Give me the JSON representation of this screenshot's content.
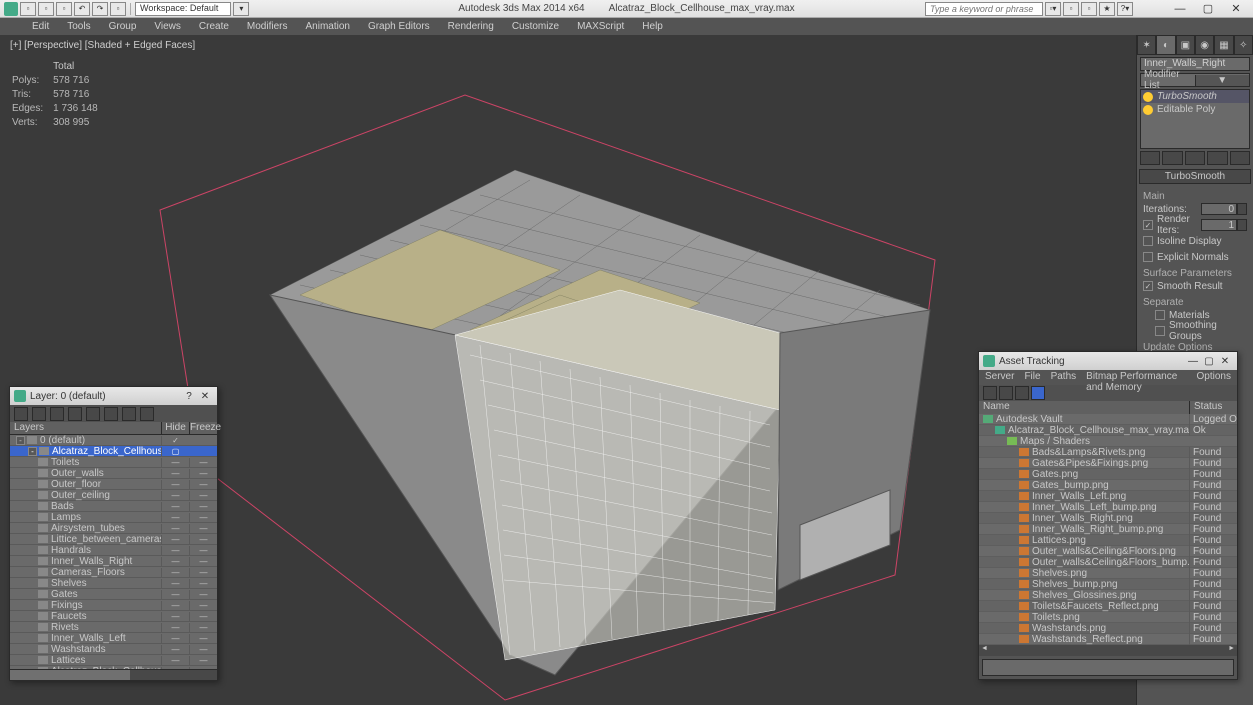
{
  "titlebar": {
    "workspace_label": "Workspace: Default",
    "app_title": "Autodesk 3ds Max 2014 x64",
    "file_title": "Alcatraz_Block_Cellhouse_max_vray.max",
    "search_placeholder": "Type a keyword or phrase",
    "quick_icons": [
      "new",
      "open",
      "save",
      "undo",
      "redo",
      "link",
      "select"
    ]
  },
  "menu": [
    "Edit",
    "Tools",
    "Group",
    "Views",
    "Create",
    "Modifiers",
    "Animation",
    "Graph Editors",
    "Rendering",
    "Customize",
    "MAXScript",
    "Help"
  ],
  "viewport": {
    "label": "[+] [Perspective] [Shaded + Edged Faces]",
    "stats_header": "Total",
    "stats": [
      {
        "k": "Polys:",
        "v": "578 716"
      },
      {
        "k": "Tris:",
        "v": "578 716"
      },
      {
        "k": "Edges:",
        "v": "1 736 148"
      },
      {
        "k": "Verts:",
        "v": "308 995"
      }
    ]
  },
  "cmdpanel": {
    "object_name": "Inner_Walls_Right",
    "modlist_label": "Modifier List",
    "stack": [
      {
        "name": "TurboSmooth",
        "italic": true,
        "on": true,
        "sel": true
      },
      {
        "name": "Editable Poly",
        "italic": false,
        "on": true,
        "sel": false
      }
    ],
    "rollout1_title": "TurboSmooth",
    "main_label": "Main",
    "iterations_label": "Iterations:",
    "iterations_val": "0",
    "render_iters_label": "Render Iters:",
    "render_iters_val": "1",
    "render_iters_checked": true,
    "isoline_label": "Isoline Display",
    "explicit_label": "Explicit Normals",
    "surface_label": "Surface Parameters",
    "smooth_result_label": "Smooth Result",
    "smooth_result_checked": true,
    "separate_label": "Separate",
    "materials_label": "Materials",
    "smoothing_groups_label": "Smoothing Groups",
    "update_label": "Update Options"
  },
  "layer_dlg": {
    "title": "Layer: 0 (default)",
    "col_layers": "Layers",
    "col_hide": "Hide",
    "col_freeze": "Freeze",
    "rows": [
      {
        "d": 0,
        "exp": "-",
        "n": "0 (default)",
        "hide": "✓"
      },
      {
        "d": 1,
        "exp": "-",
        "n": "Alcatraz_Block_Cellhouse",
        "sel": true,
        "box": true
      },
      {
        "d": 2,
        "n": "Toilets",
        "dots": true
      },
      {
        "d": 2,
        "n": "Outer_walls",
        "dots": true
      },
      {
        "d": 2,
        "n": "Outer_floor",
        "dots": true
      },
      {
        "d": 2,
        "n": "Outer_ceiling",
        "dots": true
      },
      {
        "d": 2,
        "n": "Bads",
        "dots": true
      },
      {
        "d": 2,
        "n": "Lamps",
        "dots": true
      },
      {
        "d": 2,
        "n": "Airsystem_tubes",
        "dots": true
      },
      {
        "d": 2,
        "n": "Littice_between_cameras",
        "dots": true
      },
      {
        "d": 2,
        "n": "Handrals",
        "dots": true
      },
      {
        "d": 2,
        "n": "Inner_Walls_Right",
        "dots": true
      },
      {
        "d": 2,
        "n": "Cameras_Floors",
        "dots": true
      },
      {
        "d": 2,
        "n": "Shelves",
        "dots": true
      },
      {
        "d": 2,
        "n": "Gates",
        "dots": true
      },
      {
        "d": 2,
        "n": "Fixings",
        "dots": true
      },
      {
        "d": 2,
        "n": "Faucets",
        "dots": true
      },
      {
        "d": 2,
        "n": "Rivets",
        "dots": true
      },
      {
        "d": 2,
        "n": "Inner_Walls_Left",
        "dots": true
      },
      {
        "d": 2,
        "n": "Washstands",
        "dots": true
      },
      {
        "d": 2,
        "n": "Lattices",
        "dots": true
      },
      {
        "d": 2,
        "n": "Alcatraz_Block_Cellhouse",
        "dots": true
      }
    ]
  },
  "asset_dlg": {
    "title": "Asset Tracking",
    "menu": [
      "Server",
      "File",
      "Paths",
      "Bitmap Performance and Memory",
      "Options"
    ],
    "col_name": "Name",
    "col_status": "Status",
    "rows": [
      {
        "d": 0,
        "ic": "#5a7",
        "n": "Autodesk Vault",
        "st": "Logged O"
      },
      {
        "d": 1,
        "ic": "#4a8",
        "n": "Alcatraz_Block_Cellhouse_max_vray.max",
        "st": "Ok"
      },
      {
        "d": 2,
        "ic": "#7b5",
        "n": "Maps / Shaders",
        "st": ""
      },
      {
        "d": 3,
        "ic": "#c73",
        "n": "Bads&Lamps&Rivets.png",
        "st": "Found"
      },
      {
        "d": 3,
        "ic": "#c73",
        "n": "Gates&Pipes&Fixings.png",
        "st": "Found"
      },
      {
        "d": 3,
        "ic": "#c73",
        "n": "Gates.png",
        "st": "Found"
      },
      {
        "d": 3,
        "ic": "#c73",
        "n": "Gates_bump.png",
        "st": "Found"
      },
      {
        "d": 3,
        "ic": "#c73",
        "n": "Inner_Walls_Left.png",
        "st": "Found"
      },
      {
        "d": 3,
        "ic": "#c73",
        "n": "Inner_Walls_Left_bump.png",
        "st": "Found"
      },
      {
        "d": 3,
        "ic": "#c73",
        "n": "Inner_Walls_Right.png",
        "st": "Found"
      },
      {
        "d": 3,
        "ic": "#c73",
        "n": "Inner_Walls_Right_bump.png",
        "st": "Found"
      },
      {
        "d": 3,
        "ic": "#c73",
        "n": "Lattices.png",
        "st": "Found"
      },
      {
        "d": 3,
        "ic": "#c73",
        "n": "Outer_walls&Ceiling&Floors.png",
        "st": "Found"
      },
      {
        "d": 3,
        "ic": "#c73",
        "n": "Outer_walls&Ceiling&Floors_bump.png",
        "st": "Found"
      },
      {
        "d": 3,
        "ic": "#c73",
        "n": "Shelves.png",
        "st": "Found"
      },
      {
        "d": 3,
        "ic": "#c73",
        "n": "Shelves_bump.png",
        "st": "Found"
      },
      {
        "d": 3,
        "ic": "#c73",
        "n": "Shelves_Glossines.png",
        "st": "Found"
      },
      {
        "d": 3,
        "ic": "#c73",
        "n": "Toilets&Faucets_Reflect.png",
        "st": "Found"
      },
      {
        "d": 3,
        "ic": "#c73",
        "n": "Toilets.png",
        "st": "Found"
      },
      {
        "d": 3,
        "ic": "#c73",
        "n": "Washstands.png",
        "st": "Found"
      },
      {
        "d": 3,
        "ic": "#c73",
        "n": "Washstands_Reflect.png",
        "st": "Found"
      }
    ]
  }
}
